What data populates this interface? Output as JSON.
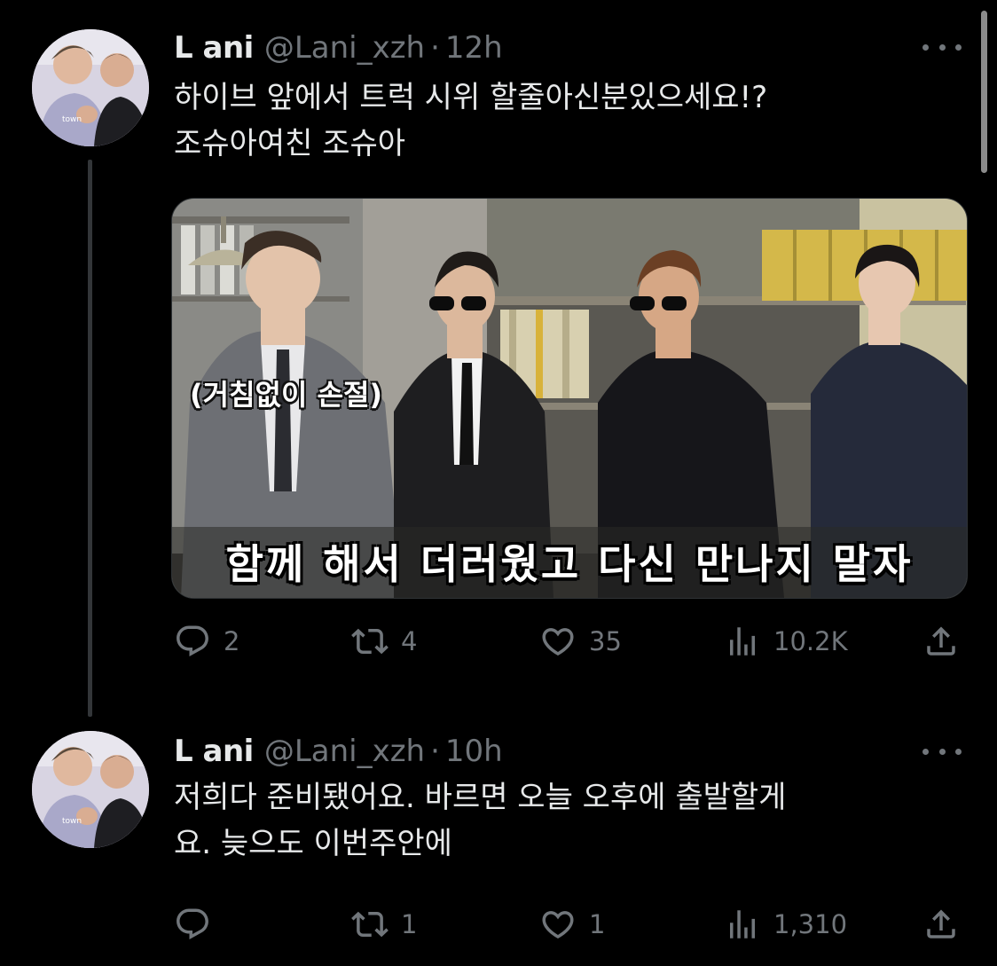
{
  "tweets": [
    {
      "author": {
        "name": "L ani",
        "handle": "@Lani_xzh"
      },
      "separator": "·",
      "time": "12h",
      "text_lines": [
        "하이브 앞에서 트럭 시위 할줄아신분있으세요!?",
        "조슈아여친 조슈아"
      ],
      "media": {
        "caption_small": "(거침없이 손절)",
        "caption_main": "함께 해서 더러웠고 다신 만나지 말자"
      },
      "actions": {
        "replies": "2",
        "retweets": "4",
        "likes": "35",
        "views": "10.2K"
      }
    },
    {
      "author": {
        "name": "L ani",
        "handle": "@Lani_xzh"
      },
      "separator": "·",
      "time": "10h",
      "text_lines": [
        "저희다 준비됐어요. 바르면 오늘 오후에 출발할게",
        "요. 늦으도 이번주안에"
      ],
      "actions": {
        "replies": "",
        "retweets": "1",
        "likes": "1",
        "views": "1,310"
      }
    }
  ],
  "icons": {
    "reply": "reply-icon",
    "retweet": "retweet-icon",
    "like": "heart-icon",
    "views": "views-icon",
    "share": "share-icon",
    "more": "more-icon"
  },
  "colors": {
    "background": "#000000",
    "text_primary": "#e7e9ea",
    "text_secondary": "#71767b",
    "thread_line": "#333639"
  }
}
